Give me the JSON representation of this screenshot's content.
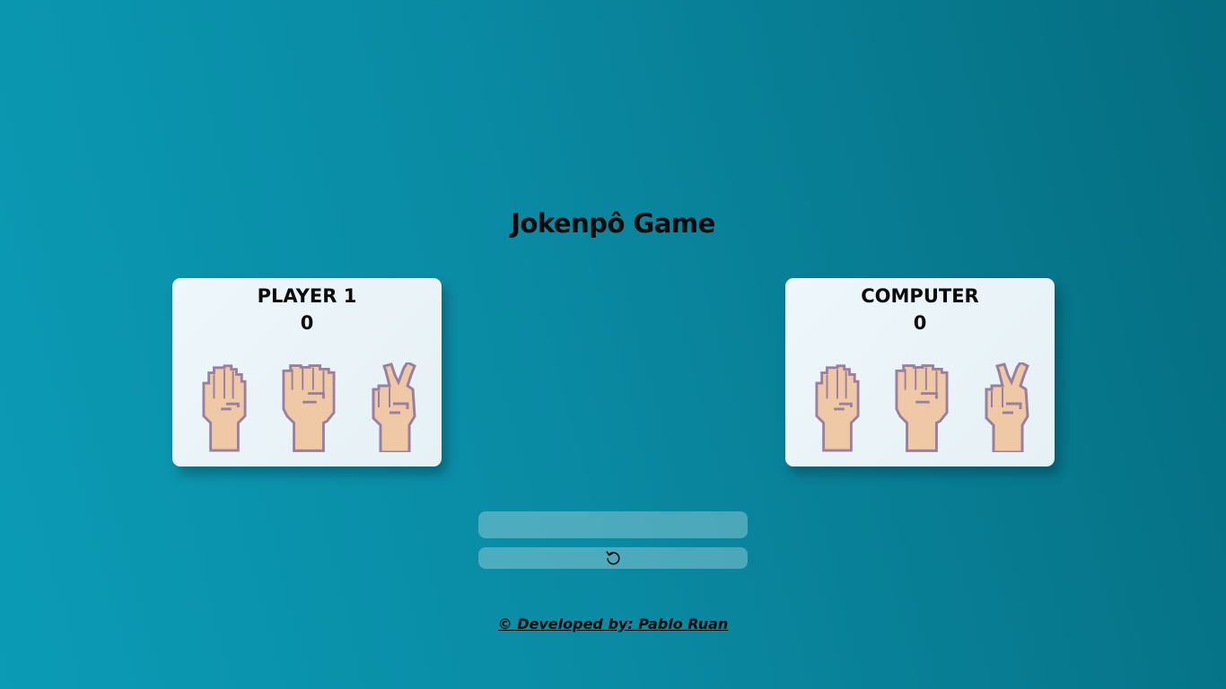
{
  "page": {
    "title": "Jokenpô Game"
  },
  "player": {
    "name": "PLAYER 1",
    "score": "0"
  },
  "computer": {
    "name": "COMPUTER",
    "score": "0"
  },
  "choices": [
    "paper",
    "rock",
    "scissors"
  ],
  "result": {
    "text": ""
  },
  "reset": {
    "icon": "reset-icon"
  },
  "footer": {
    "text": "© Developed by: Pablo Ruan"
  },
  "colors": {
    "background_start": "#0b9bb5",
    "background_end": "#056d80",
    "card_bg": "#eef7fb",
    "skin": "#efc9a6",
    "outline": "#9a7fa0"
  }
}
